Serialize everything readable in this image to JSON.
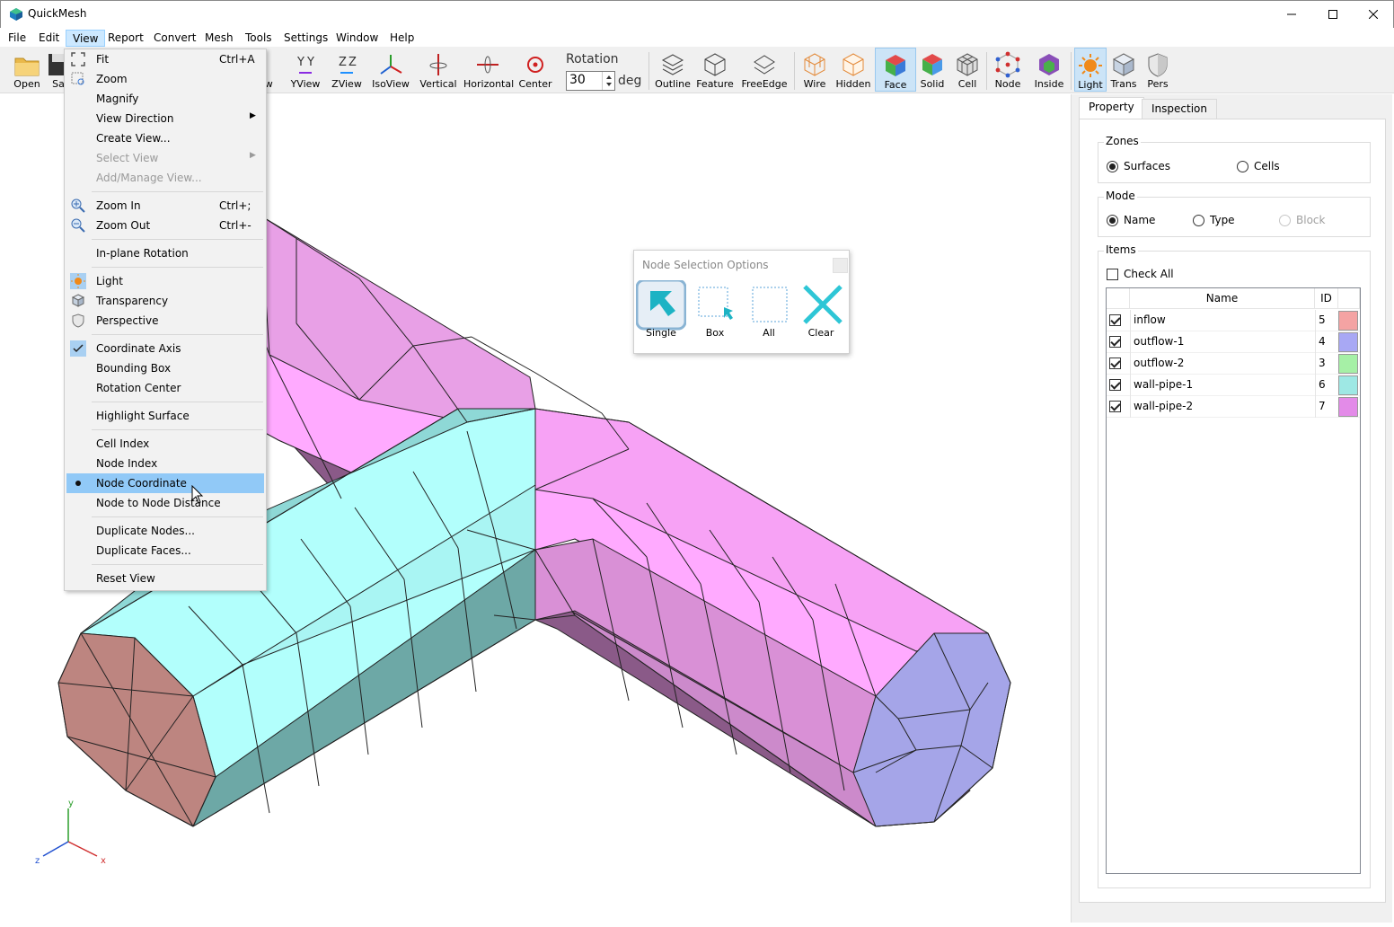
{
  "window": {
    "title": "QuickMesh"
  },
  "menubar": {
    "items": [
      "File",
      "Edit",
      "View",
      "Report",
      "Convert",
      "Mesh",
      "Tools",
      "Settings",
      "Window",
      "Help"
    ]
  },
  "toolbar": {
    "buttons": [
      "Open",
      "Sa",
      "ew",
      "YView",
      "ZView",
      "IsoView",
      "Vertical",
      "Horizontal",
      "Center",
      "Outline",
      "Feature",
      "FreeEdge",
      "Wire",
      "Hidden",
      "Face",
      "Solid",
      "Cell",
      "Node",
      "Inside",
      "Light",
      "Trans",
      "Pers"
    ],
    "rotation_label": "Rotation",
    "rotation_value": "30",
    "rotation_unit": "deg"
  },
  "view_menu": {
    "fit": "Fit",
    "fit_shortcut": "Ctrl+A",
    "zoom": "Zoom",
    "magnify": "Magnify",
    "view_direction": "View Direction",
    "create_view": "Create View...",
    "select_view": "Select View",
    "add_manage_view": "Add/Manage View...",
    "zoom_in": "Zoom In",
    "zoom_in_shortcut": "Ctrl+;",
    "zoom_out": "Zoom Out",
    "zoom_out_shortcut": "Ctrl+-",
    "inplane_rotation": "In-plane Rotation",
    "light": "Light",
    "transparency": "Transparency",
    "perspective": "Perspective",
    "coordinate_axis": "Coordinate Axis",
    "bounding_box": "Bounding Box",
    "rotation_center": "Rotation Center",
    "highlight_surface": "Highlight Surface",
    "cell_index": "Cell Index",
    "node_index": "Node Index",
    "node_coordinate": "Node Coordinate",
    "node_to_node_distance": "Node to Node Distance",
    "duplicate_nodes": "Duplicate Nodes...",
    "duplicate_faces": "Duplicate Faces...",
    "reset_view": "Reset View"
  },
  "node_selection": {
    "title": "Node Selection Options",
    "single": "Single",
    "box": "Box",
    "all": "All",
    "clear": "Clear"
  },
  "panel": {
    "tabs": [
      "Property",
      "Inspection"
    ],
    "zones_title": "Zones",
    "zones_surfaces": "Surfaces",
    "zones_cells": "Cells",
    "mode_title": "Mode",
    "mode_name": "Name",
    "mode_type": "Type",
    "mode_block": "Block",
    "items_title": "Items",
    "check_all": "Check All",
    "col_name": "Name",
    "col_id": "ID",
    "rows": [
      {
        "name": "inflow",
        "id": "5",
        "color": "#f4a3a3",
        "checked": true
      },
      {
        "name": "outflow-1",
        "id": "4",
        "color": "#a8a8f4",
        "checked": true
      },
      {
        "name": "outflow-2",
        "id": "3",
        "color": "#a6f0a6",
        "checked": true
      },
      {
        "name": "wall-pipe-1",
        "id": "6",
        "color": "#9ee8e4",
        "checked": true
      },
      {
        "name": "wall-pipe-2",
        "id": "7",
        "color": "#e38be8",
        "checked": true
      }
    ]
  },
  "axis": {
    "x": "x",
    "y": "y",
    "z": "z"
  },
  "colors": {
    "accent": "#91c9f7",
    "pipe1_top": "#b2fffc",
    "pipe1_side": "#6da8a6",
    "pipe2_top": "#ffaaff",
    "pipe2_side": "#8a5a88",
    "inflow": "#bd8580",
    "outflow1": "#a5a5e8"
  }
}
